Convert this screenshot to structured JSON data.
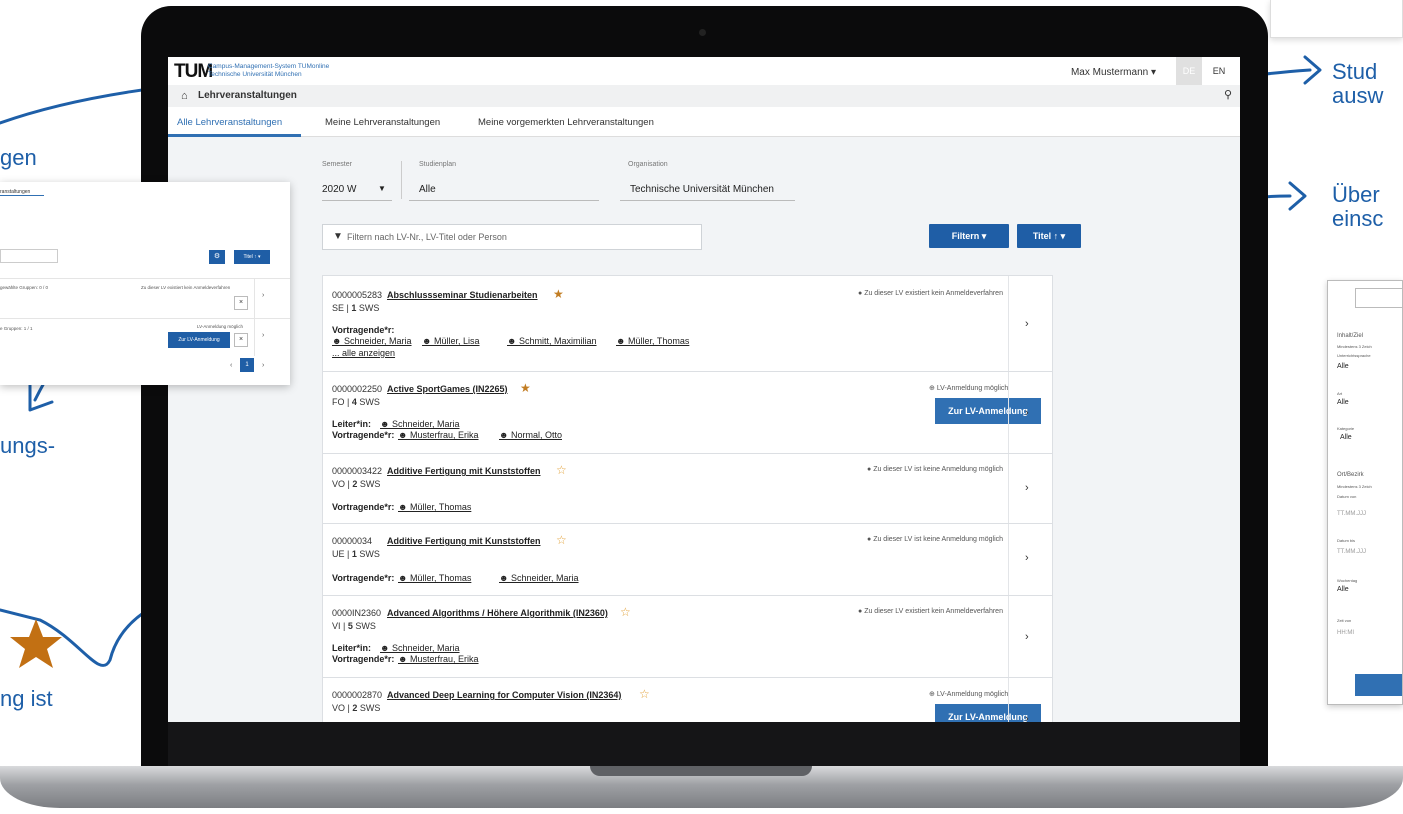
{
  "annotations": {
    "left_1": "gen",
    "left_2": "ungs-",
    "left_3": "ng ist",
    "right_1a": "Stud",
    "right_1b": "ausw",
    "right_2a": "Über",
    "right_2b": "einsc"
  },
  "app": {
    "logo": "TUM",
    "brand_line1": "Campus-Management-System TUMonline",
    "brand_line2": "Technische Universität München",
    "user_menu": "Max Mustermann ▾",
    "lang_de": "DE",
    "lang_en": "EN"
  },
  "breadcrumb": {
    "title": "Lehrveranstaltungen"
  },
  "tabs": [
    "Alle Lehrveranstaltungen",
    "Meine Lehrveranstaltungen",
    "Meine vorgemerkten Lehrveranstaltungen"
  ],
  "filters": {
    "semester_label": "Semester",
    "semester_value": "2020 W",
    "studienplan_label": "Studienplan",
    "studienplan_value": "Alle",
    "organisation_label": "Organisation",
    "organisation_value": "Technische Universität München",
    "search_placeholder": "Filtern nach LV-Nr., LV-Titel oder Person",
    "filter_button": "Filtern ▾",
    "sort_button": "Titel ↑ ▾"
  },
  "courses": [
    {
      "number": "0000005283",
      "title": "Abschlussseminar Studienarbeiten",
      "starred": true,
      "type": "SE",
      "sws": "1",
      "sws_label": "SWS",
      "status": "Zu dieser LV existiert kein Anmeldeverfahren",
      "role": "Vortragende*r:",
      "people": [
        "Schneider, Maria",
        "Müller, Lisa",
        "Schmitt, Maximilian",
        "Müller, Thomas"
      ],
      "more": "... alle anzeigen"
    },
    {
      "number": "0000002250",
      "title": "Active SportGames (IN2265)",
      "starred": true,
      "type": "FO",
      "sws": "4",
      "sws_label": "SWS",
      "status": "LV-Anmeldung möglich",
      "button": "Zur LV-Anmeldung",
      "role_1": "Leiter*in:",
      "people_1": [
        "Schneider, Maria"
      ],
      "role_2": "Vortragende*r:",
      "people_2": [
        "Musterfrau, Erika",
        "Normal, Otto"
      ]
    },
    {
      "number": "0000003422",
      "title": "Additive Fertigung mit Kunststoffen",
      "starred": false,
      "type": "VO",
      "sws": "2",
      "sws_label": "SWS",
      "status": "Zu dieser LV ist keine Anmeldung möglich",
      "role": "Vortragende*r:",
      "people": [
        "Müller, Thomas"
      ]
    },
    {
      "number": "00000034",
      "title": "Additive Fertigung mit Kunststoffen",
      "starred": false,
      "type": "UE",
      "sws": "1",
      "sws_label": "SWS",
      "status": "Zu dieser LV ist keine Anmeldung möglich",
      "role": "Vortragende*r:",
      "people": [
        "Müller, Thomas",
        "Schneider, Maria"
      ]
    },
    {
      "number": "0000IN2360",
      "title": "Advanced Algorithms / Höhere Algorithmik (IN2360)",
      "starred": false,
      "type": "VI",
      "sws": "5",
      "sws_label": "SWS",
      "status": "Zu dieser LV existiert kein Anmeldeverfahren",
      "role_1": "Leiter*in:",
      "people_1": [
        "Schneider, Maria"
      ],
      "role_2": "Vortragende*r:",
      "people_2": [
        "Musterfrau, Erika"
      ]
    },
    {
      "number": "0000002870",
      "title": "Advanced Deep Learning for Computer Vision (IN2364)",
      "starred": false,
      "type": "VO",
      "sws": "2",
      "sws_label": "SWS",
      "status": "LV-Anmeldung möglich",
      "button": "Zur LV-Anmeldung"
    }
  ],
  "mini_left": {
    "tab": "ranstaltungen",
    "sort": "Titel ↑ ▾",
    "row1_text": "gewählte Gruppen: 0 / 0",
    "row1_status": "Zu dieser LV existiert kein Anmeldeverfahren",
    "row2_text": "e Gruppen: 1 / 1",
    "row2_status": "LV-Anmeldung möglich",
    "row2_button": "Zur LV-Anmeldung",
    "page": "1"
  },
  "mini_right": {
    "inhalt": "Inhalt/Ziel",
    "hint1": "Mindestens 3 Zeich",
    "hint2": "Unterrichtssprache",
    "alle1": "Alle",
    "art": "Art",
    "alle2": "Alle",
    "kategorie": "Kategorie",
    "alle3": "Alle",
    "ort": "Ort/Bezirk",
    "hint3": "Mindestens 3 Zeich",
    "datum_von": "Datum von",
    "tt1": "TT.MM.JJJ",
    "datum_bis": "Datum bis",
    "tt2": "TT.MM.JJJ",
    "wochentag": "Wochentag",
    "alle4": "Alle",
    "zeit_von": "Zeit von",
    "hhmi": "HH:MI"
  }
}
